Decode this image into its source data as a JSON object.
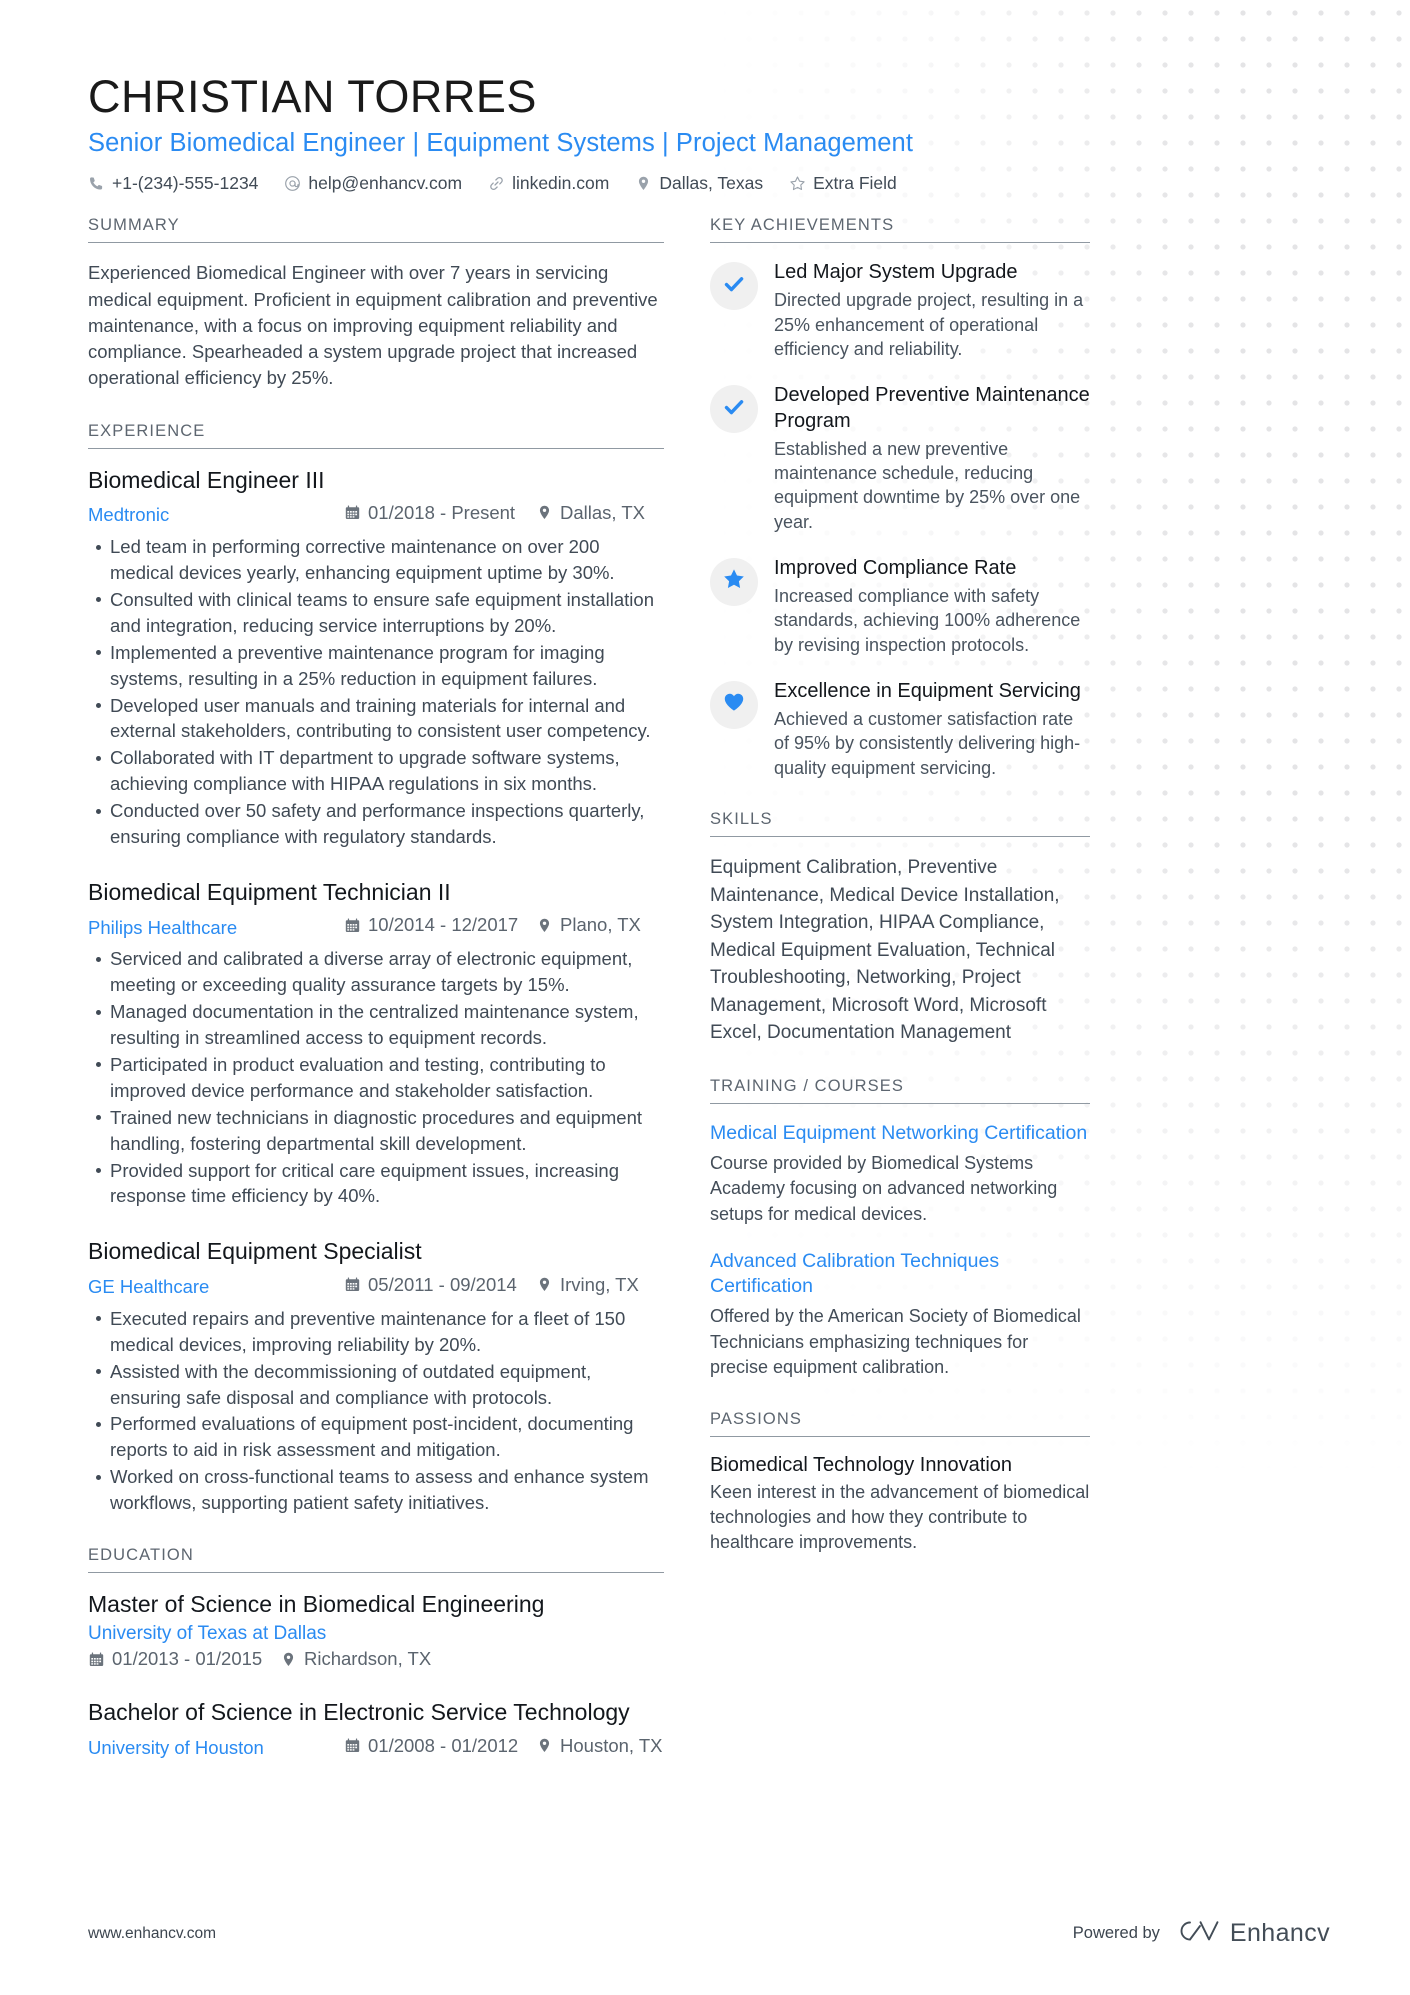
{
  "theme": {
    "accent": "#2a8bf2",
    "text": "#404a55",
    "heading": "#5d6670",
    "badge_bg": "#f0f0f0"
  },
  "header": {
    "name": "CHRISTIAN TORRES",
    "headline": "Senior Biomedical Engineer | Equipment Systems | Project Management",
    "contacts": [
      {
        "icon": "phone-icon",
        "text": "+1-(234)-555-1234"
      },
      {
        "icon": "email-icon",
        "text": "help@enhancv.com"
      },
      {
        "icon": "link-icon",
        "text": "linkedin.com"
      },
      {
        "icon": "location-pin-icon",
        "text": "Dallas, Texas"
      },
      {
        "icon": "star-outline-icon",
        "text": "Extra Field"
      }
    ]
  },
  "left": {
    "summary": {
      "heading": "SUMMARY",
      "text": "Experienced Biomedical Engineer with over 7 years in servicing medical equipment. Proficient in equipment calibration and preventive maintenance, with a focus on improving equipment reliability and compliance. Spearheaded a system upgrade project that increased operational efficiency by 25%."
    },
    "experience": {
      "heading": "EXPERIENCE",
      "entries": [
        {
          "title": "Biomedical Engineer III",
          "company": "Medtronic",
          "dates": "01/2018 - Present",
          "location": "Dallas, TX",
          "bullets": [
            "Led team in performing corrective maintenance on over 200 medical devices yearly, enhancing equipment uptime by 30%.",
            "Consulted with clinical teams to ensure safe equipment installation and integration, reducing service interruptions by 20%.",
            "Implemented a preventive maintenance program for imaging systems, resulting in a 25% reduction in equipment failures.",
            "Developed user manuals and training materials for internal and external stakeholders, contributing to consistent user competency.",
            "Collaborated with IT department to upgrade software systems, achieving compliance with HIPAA regulations in six months.",
            "Conducted over 50 safety and performance inspections quarterly, ensuring compliance with regulatory standards."
          ]
        },
        {
          "title": "Biomedical Equipment Technician II",
          "company": "Philips Healthcare",
          "dates": "10/2014 - 12/2017",
          "location": "Plano, TX",
          "bullets": [
            "Serviced and calibrated a diverse array of electronic equipment, meeting or exceeding quality assurance targets by 15%.",
            "Managed documentation in the centralized maintenance system, resulting in streamlined access to equipment records.",
            "Participated in product evaluation and testing, contributing to improved device performance and stakeholder satisfaction.",
            "Trained new technicians in diagnostic procedures and equipment handling, fostering departmental skill development.",
            "Provided support for critical care equipment issues, increasing response time efficiency by 40%."
          ]
        },
        {
          "title": "Biomedical Equipment Specialist",
          "company": "GE Healthcare",
          "dates": "05/2011 - 09/2014",
          "location": "Irving, TX",
          "bullets": [
            "Executed repairs and preventive maintenance for a fleet of 150 medical devices, improving reliability by 20%.",
            "Assisted with the decommissioning of outdated equipment, ensuring safe disposal and compliance with protocols.",
            "Performed evaluations of equipment post-incident, documenting reports to aid in risk assessment and mitigation.",
            "Worked on cross-functional teams to assess and enhance system workflows, supporting patient safety initiatives."
          ]
        }
      ]
    },
    "education": {
      "heading": "EDUCATION",
      "entries": [
        {
          "degree": "Master of Science in Biomedical Engineering",
          "school": "University of Texas at Dallas",
          "dates": "01/2013 - 01/2015",
          "location": "Richardson, TX",
          "inline": false
        },
        {
          "degree": "Bachelor of Science in Electronic Service Technology",
          "school": "University of Houston",
          "dates": "01/2008 - 01/2012",
          "location": "Houston, TX",
          "inline": true
        }
      ]
    }
  },
  "right": {
    "achievements": {
      "heading": "KEY ACHIEVEMENTS",
      "items": [
        {
          "icon": "check-icon",
          "title": "Led Major System Upgrade",
          "desc": "Directed upgrade project, resulting in a 25% enhancement of operational efficiency and reliability."
        },
        {
          "icon": "check-icon",
          "title": "Developed Preventive Maintenance Program",
          "desc": "Established a new preventive maintenance schedule, reducing equipment downtime by 25% over one year."
        },
        {
          "icon": "star-icon",
          "title": "Improved Compliance Rate",
          "desc": "Increased compliance with safety standards, achieving 100% adherence by revising inspection protocols."
        },
        {
          "icon": "heart-icon",
          "title": "Excellence in Equipment Servicing",
          "desc": "Achieved a customer satisfaction rate of 95% by consistently delivering high-quality equipment servicing."
        }
      ]
    },
    "skills": {
      "heading": "SKILLS",
      "text": "Equipment Calibration, Preventive Maintenance, Medical Device Installation, System Integration, HIPAA Compliance, Medical Equipment Evaluation, Technical Troubleshooting, Networking, Project Management, Microsoft Word, Microsoft Excel, Documentation Management"
    },
    "training": {
      "heading": "TRAINING / COURSES",
      "items": [
        {
          "title": "Medical Equipment Networking Certification",
          "desc": "Course provided by Biomedical Systems Academy focusing on advanced networking setups for medical devices."
        },
        {
          "title": "Advanced Calibration Techniques Certification",
          "desc": "Offered by the American Society of Biomedical Technicians emphasizing techniques for precise equipment calibration."
        }
      ]
    },
    "passions": {
      "heading": "PASSIONS",
      "items": [
        {
          "title": "Biomedical Technology Innovation",
          "desc": "Keen interest in the advancement of biomedical technologies and how they contribute to healthcare improvements."
        }
      ]
    }
  },
  "footer": {
    "url": "www.enhancv.com",
    "powered_label": "Powered by",
    "brand": "Enhancv"
  }
}
